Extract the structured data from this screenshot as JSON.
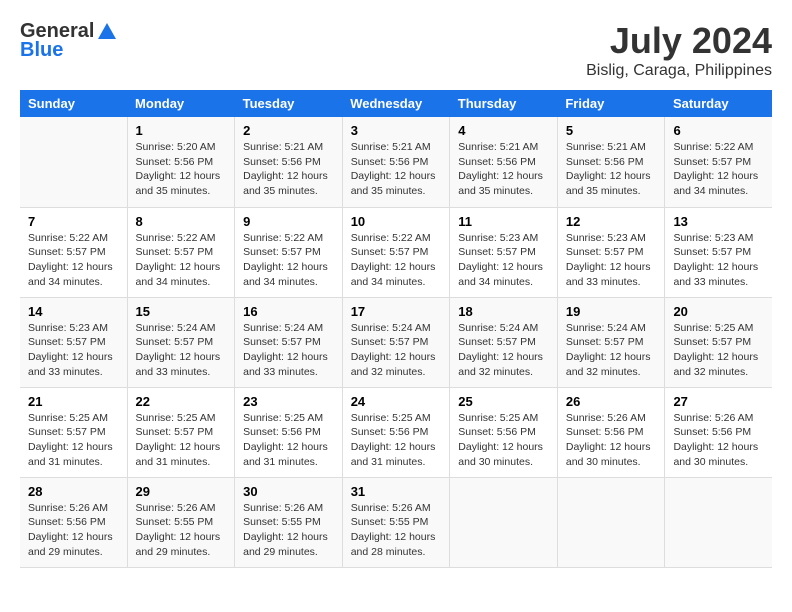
{
  "header": {
    "logo_general": "General",
    "logo_blue": "Blue",
    "month_year": "July 2024",
    "location": "Bislig, Caraga, Philippines"
  },
  "days_of_week": [
    "Sunday",
    "Monday",
    "Tuesday",
    "Wednesday",
    "Thursday",
    "Friday",
    "Saturday"
  ],
  "weeks": [
    [
      {
        "day": "",
        "info": ""
      },
      {
        "day": "1",
        "info": "Sunrise: 5:20 AM\nSunset: 5:56 PM\nDaylight: 12 hours\nand 35 minutes."
      },
      {
        "day": "2",
        "info": "Sunrise: 5:21 AM\nSunset: 5:56 PM\nDaylight: 12 hours\nand 35 minutes."
      },
      {
        "day": "3",
        "info": "Sunrise: 5:21 AM\nSunset: 5:56 PM\nDaylight: 12 hours\nand 35 minutes."
      },
      {
        "day": "4",
        "info": "Sunrise: 5:21 AM\nSunset: 5:56 PM\nDaylight: 12 hours\nand 35 minutes."
      },
      {
        "day": "5",
        "info": "Sunrise: 5:21 AM\nSunset: 5:56 PM\nDaylight: 12 hours\nand 35 minutes."
      },
      {
        "day": "6",
        "info": "Sunrise: 5:22 AM\nSunset: 5:57 PM\nDaylight: 12 hours\nand 34 minutes."
      }
    ],
    [
      {
        "day": "7",
        "info": "Sunrise: 5:22 AM\nSunset: 5:57 PM\nDaylight: 12 hours\nand 34 minutes."
      },
      {
        "day": "8",
        "info": "Sunrise: 5:22 AM\nSunset: 5:57 PM\nDaylight: 12 hours\nand 34 minutes."
      },
      {
        "day": "9",
        "info": "Sunrise: 5:22 AM\nSunset: 5:57 PM\nDaylight: 12 hours\nand 34 minutes."
      },
      {
        "day": "10",
        "info": "Sunrise: 5:22 AM\nSunset: 5:57 PM\nDaylight: 12 hours\nand 34 minutes."
      },
      {
        "day": "11",
        "info": "Sunrise: 5:23 AM\nSunset: 5:57 PM\nDaylight: 12 hours\nand 34 minutes."
      },
      {
        "day": "12",
        "info": "Sunrise: 5:23 AM\nSunset: 5:57 PM\nDaylight: 12 hours\nand 33 minutes."
      },
      {
        "day": "13",
        "info": "Sunrise: 5:23 AM\nSunset: 5:57 PM\nDaylight: 12 hours\nand 33 minutes."
      }
    ],
    [
      {
        "day": "14",
        "info": "Sunrise: 5:23 AM\nSunset: 5:57 PM\nDaylight: 12 hours\nand 33 minutes."
      },
      {
        "day": "15",
        "info": "Sunrise: 5:24 AM\nSunset: 5:57 PM\nDaylight: 12 hours\nand 33 minutes."
      },
      {
        "day": "16",
        "info": "Sunrise: 5:24 AM\nSunset: 5:57 PM\nDaylight: 12 hours\nand 33 minutes."
      },
      {
        "day": "17",
        "info": "Sunrise: 5:24 AM\nSunset: 5:57 PM\nDaylight: 12 hours\nand 32 minutes."
      },
      {
        "day": "18",
        "info": "Sunrise: 5:24 AM\nSunset: 5:57 PM\nDaylight: 12 hours\nand 32 minutes."
      },
      {
        "day": "19",
        "info": "Sunrise: 5:24 AM\nSunset: 5:57 PM\nDaylight: 12 hours\nand 32 minutes."
      },
      {
        "day": "20",
        "info": "Sunrise: 5:25 AM\nSunset: 5:57 PM\nDaylight: 12 hours\nand 32 minutes."
      }
    ],
    [
      {
        "day": "21",
        "info": "Sunrise: 5:25 AM\nSunset: 5:57 PM\nDaylight: 12 hours\nand 31 minutes."
      },
      {
        "day": "22",
        "info": "Sunrise: 5:25 AM\nSunset: 5:57 PM\nDaylight: 12 hours\nand 31 minutes."
      },
      {
        "day": "23",
        "info": "Sunrise: 5:25 AM\nSunset: 5:56 PM\nDaylight: 12 hours\nand 31 minutes."
      },
      {
        "day": "24",
        "info": "Sunrise: 5:25 AM\nSunset: 5:56 PM\nDaylight: 12 hours\nand 31 minutes."
      },
      {
        "day": "25",
        "info": "Sunrise: 5:25 AM\nSunset: 5:56 PM\nDaylight: 12 hours\nand 30 minutes."
      },
      {
        "day": "26",
        "info": "Sunrise: 5:26 AM\nSunset: 5:56 PM\nDaylight: 12 hours\nand 30 minutes."
      },
      {
        "day": "27",
        "info": "Sunrise: 5:26 AM\nSunset: 5:56 PM\nDaylight: 12 hours\nand 30 minutes."
      }
    ],
    [
      {
        "day": "28",
        "info": "Sunrise: 5:26 AM\nSunset: 5:56 PM\nDaylight: 12 hours\nand 29 minutes."
      },
      {
        "day": "29",
        "info": "Sunrise: 5:26 AM\nSunset: 5:55 PM\nDaylight: 12 hours\nand 29 minutes."
      },
      {
        "day": "30",
        "info": "Sunrise: 5:26 AM\nSunset: 5:55 PM\nDaylight: 12 hours\nand 29 minutes."
      },
      {
        "day": "31",
        "info": "Sunrise: 5:26 AM\nSunset: 5:55 PM\nDaylight: 12 hours\nand 28 minutes."
      },
      {
        "day": "",
        "info": ""
      },
      {
        "day": "",
        "info": ""
      },
      {
        "day": "",
        "info": ""
      }
    ]
  ]
}
